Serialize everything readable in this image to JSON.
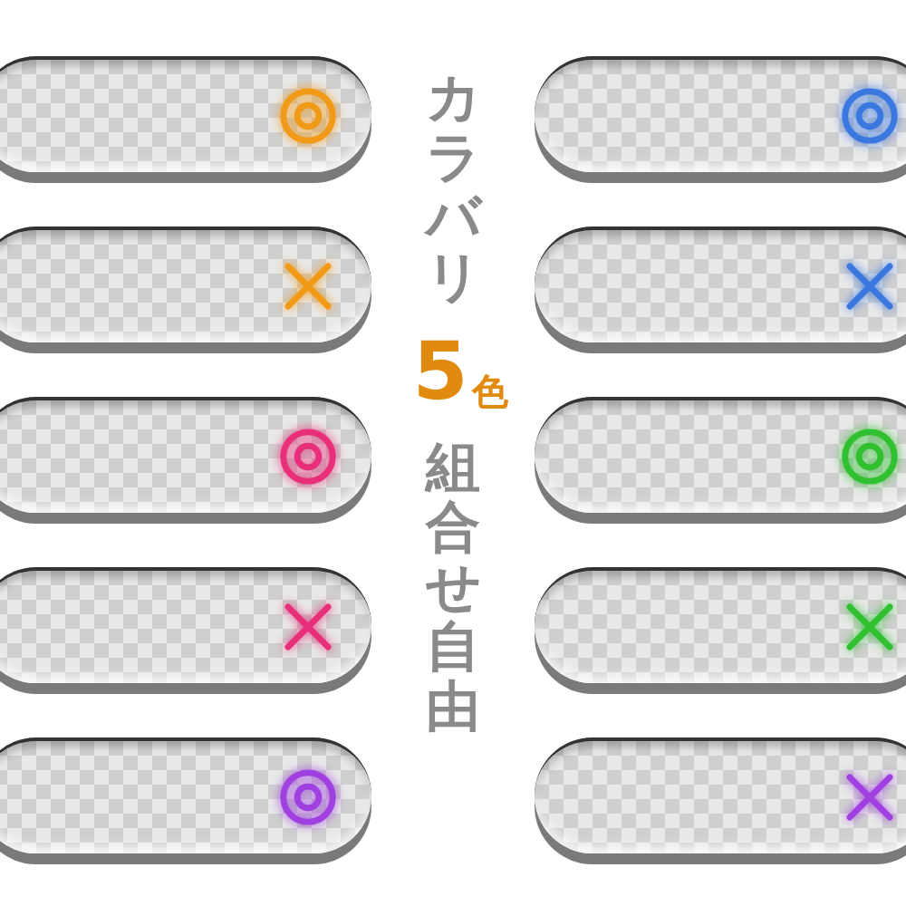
{
  "left_buttons": [
    {
      "kind": "circle",
      "color": "#f09a18"
    },
    {
      "kind": "cross",
      "color": "#f09a18"
    },
    {
      "kind": "circle",
      "color": "#e8307a"
    },
    {
      "kind": "cross",
      "color": "#e8307a"
    },
    {
      "kind": "circle",
      "color": "#a040e0"
    }
  ],
  "caption": {
    "top": "カラバリ",
    "count": "5",
    "unit": "色",
    "bottom": "組合せ自由"
  },
  "right_buttons": [
    {
      "kind": "circle",
      "color": "#3a78e0"
    },
    {
      "kind": "cross",
      "color": "#3a78e0"
    },
    {
      "kind": "circle",
      "color": "#30c030"
    },
    {
      "kind": "cross",
      "color": "#30c030"
    },
    {
      "kind": "cross",
      "color": "#a040e0"
    }
  ]
}
